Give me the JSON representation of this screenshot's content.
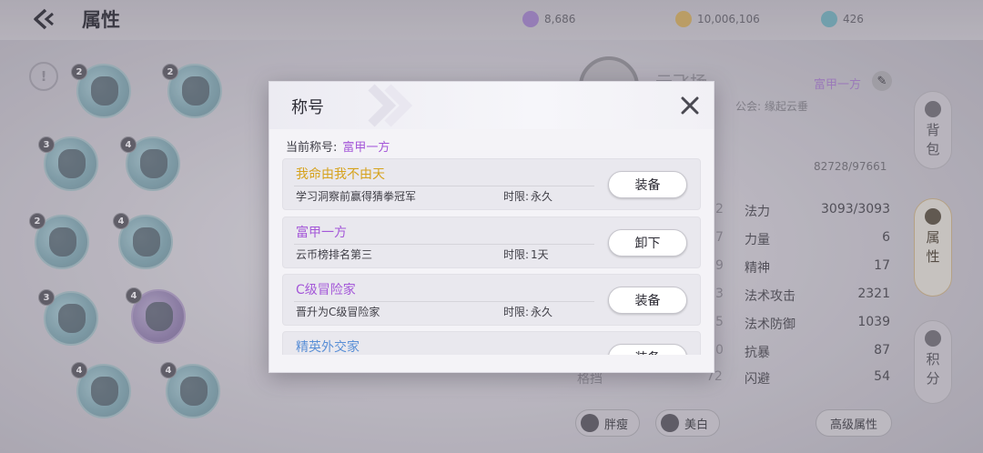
{
  "header": {
    "title": "属性"
  },
  "resources": [
    {
      "icon": "crystal-icon",
      "value": "8,686",
      "color": "#9b7fc2"
    },
    {
      "icon": "coin-icon",
      "value": "10,006,106",
      "color": "#c9a760"
    },
    {
      "icon": "gem-icon",
      "value": "426",
      "color": "#6fa9b6"
    }
  ],
  "equipment_badges": [
    "2",
    "2",
    "3",
    "4",
    "2",
    "4",
    "3",
    "4",
    "4",
    "4"
  ],
  "character": {
    "name": "云飞扬",
    "guild": "公会: 缘起云垂",
    "title": "富甲一方",
    "hp": "82728/97661"
  },
  "stats": [
    {
      "label": "法力",
      "value": "3093/3093"
    },
    {
      "label": "力量",
      "value": "6"
    },
    {
      "label": "精神",
      "value": "17"
    },
    {
      "label": "法术攻击",
      "value": "2321"
    },
    {
      "label": "法术防御",
      "value": "1039"
    },
    {
      "label": "抗暴",
      "value": "87"
    },
    {
      "label": "闪避",
      "value": "54"
    }
  ],
  "left_stat_fragments": [
    "2",
    "7",
    "9",
    "3",
    "5",
    "0",
    "72"
  ],
  "left_stat_label_fragment": "格挡",
  "side_tabs": [
    {
      "label_1": "背",
      "label_2": "包"
    },
    {
      "label_1": "属",
      "label_2": "性"
    },
    {
      "label_1": "积",
      "label_2": "分"
    }
  ],
  "bottom_buttons": {
    "fat": "胖瘦",
    "whiten": "美白",
    "advanced": "高级属性"
  },
  "modal": {
    "title": "称号",
    "current_label": "当前称号:",
    "current_value": "富甲一方",
    "limit_label": "时限:",
    "titles": [
      {
        "name": "我命由我不由天",
        "color": "#d6a21c",
        "desc": "学习洞察前赢得猜拳冠军",
        "limit": "永久",
        "button": "装备"
      },
      {
        "name": "富甲一方",
        "color": "#a457d8",
        "desc": "云币榜排名第三",
        "limit": "1天",
        "button": "卸下"
      },
      {
        "name": "C级冒险家",
        "color": "#a457d8",
        "desc": "晋升为C级冒险家",
        "limit": "永久",
        "button": "装备"
      },
      {
        "name": "精英外交家",
        "color": "#5a8fd6",
        "desc": "",
        "limit": "",
        "button": "装备"
      }
    ]
  }
}
